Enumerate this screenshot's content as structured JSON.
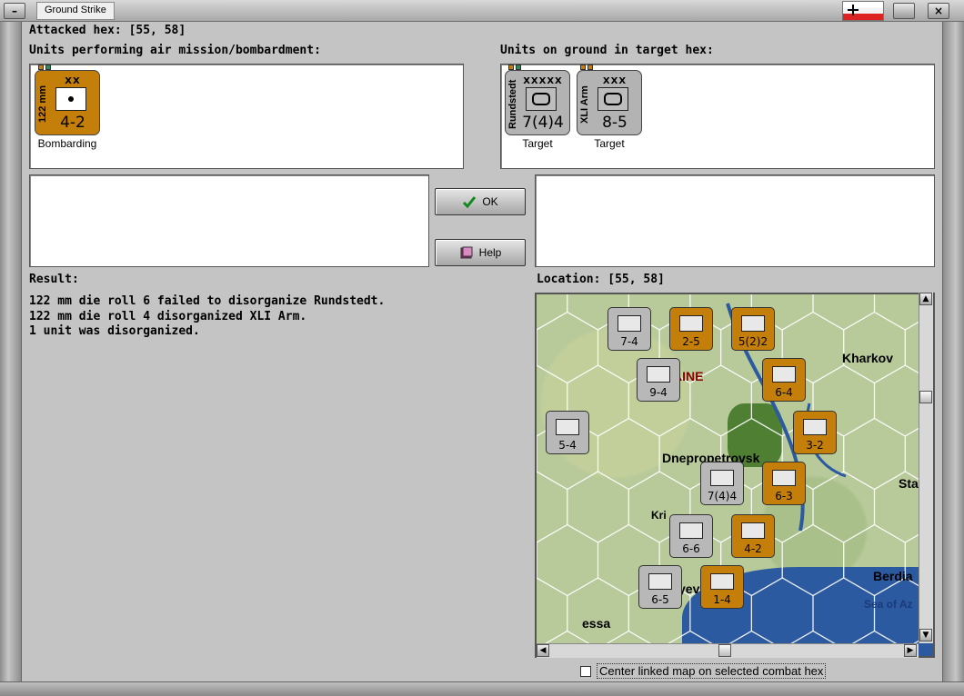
{
  "window": {
    "title": "Ground Strike",
    "minimize_glyph": "–",
    "close_glyph": "×"
  },
  "header": {
    "attacked_hex": "Attacked hex:  [55, 58]"
  },
  "air_panel": {
    "label": "Units performing air mission/bombardment:",
    "units": [
      {
        "side_text": "122 mm",
        "size": "XX",
        "stats": "4-2",
        "caption": "Bombarding",
        "color": "#c47f0b",
        "pips": [
          "#c47f0b",
          "#2e8b57"
        ]
      }
    ]
  },
  "ground_panel": {
    "label": "Units on ground in target hex:",
    "units": [
      {
        "side_text": "Rundstedt",
        "size": "XXXXX",
        "stats": "7(4)4",
        "caption": "Target",
        "color": "#b3b3b3",
        "pips": [
          "#c47f0b",
          "#2e8b57"
        ]
      },
      {
        "side_text": "XLI Arm",
        "size": "XXX",
        "stats": "8-5",
        "caption": "Target",
        "color": "#b3b3b3",
        "pips": [
          "#c47f0b",
          "#c47f0b"
        ]
      }
    ]
  },
  "buttons": {
    "ok": "OK",
    "help": "Help",
    "ok_icon": "checkmark-icon",
    "help_icon": "help-book-icon"
  },
  "result": {
    "label": "Result:",
    "lines": [
      "122 mm die roll 6 failed to disorganize Rundstedt.",
      "122 mm die roll 4 disorganized XLI Arm.",
      "1 unit was disorganized."
    ]
  },
  "location": {
    "label": "Location:  [55, 58]"
  },
  "map": {
    "places": {
      "kharkov": "Kharkov",
      "dnepro": "Dnepropetrovsk",
      "ukraine": "AINE",
      "berdiansk": "Berdia",
      "sea": "Sea of Az",
      "odessa": "essa",
      "krivoi": "Kri",
      "stalino": "Sta",
      "zap": "yev"
    },
    "units": [
      {
        "id": "u1",
        "stats": "7-4",
        "tone": "g"
      },
      {
        "id": "u2",
        "stats": "2-5",
        "tone": "o"
      },
      {
        "id": "u3",
        "stats": "5(2)2",
        "tone": "o"
      },
      {
        "id": "u4",
        "stats": "6-4",
        "tone": "o"
      },
      {
        "id": "u5",
        "stats": "9-4",
        "tone": "g"
      },
      {
        "id": "u6",
        "stats": "3-2",
        "tone": "o"
      },
      {
        "id": "u7",
        "stats": "5-4",
        "tone": "g"
      },
      {
        "id": "u8",
        "stats": "7(4)4",
        "tone": "g"
      },
      {
        "id": "u9",
        "stats": "6-3",
        "tone": "o"
      },
      {
        "id": "u10",
        "stats": "6-6",
        "tone": "g"
      },
      {
        "id": "u11",
        "stats": "4-2",
        "tone": "o"
      },
      {
        "id": "u12",
        "stats": "6-5",
        "tone": "g"
      },
      {
        "id": "u13",
        "stats": "1-4",
        "tone": "o"
      }
    ]
  },
  "checkbox": {
    "label": "Center linked map on selected combat hex",
    "checked": false
  }
}
